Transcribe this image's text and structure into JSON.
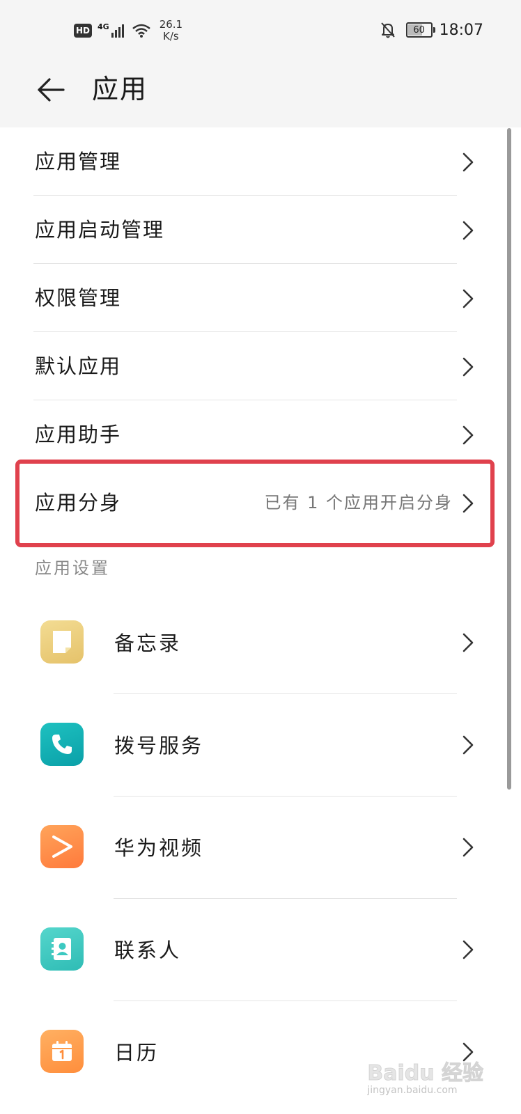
{
  "status_bar": {
    "hd": "HD",
    "network": "4G",
    "speed_value": "26.1",
    "speed_unit": "K/s",
    "battery": "60",
    "time": "18:07",
    "icons": [
      "signal-icon",
      "wifi-icon",
      "notifications-off-icon",
      "battery-icon"
    ]
  },
  "header": {
    "title": "应用",
    "back_icon": "arrow-left-icon"
  },
  "menu": [
    {
      "label": "应用管理"
    },
    {
      "label": "应用启动管理"
    },
    {
      "label": "权限管理"
    },
    {
      "label": "默认应用"
    },
    {
      "label": "应用助手"
    },
    {
      "label": "应用分身",
      "value": "已有 1 个应用开启分身",
      "highlighted": true
    }
  ],
  "app_settings": {
    "header": "应用设置",
    "items": [
      {
        "label": "备忘录",
        "icon": "notepad-icon",
        "color": "#e9cd7c"
      },
      {
        "label": "拨号服务",
        "icon": "phone-icon",
        "color": "#16b3b6"
      },
      {
        "label": "华为视频",
        "icon": "play-icon",
        "color": "#ff8f4a"
      },
      {
        "label": "联系人",
        "icon": "contacts-icon",
        "color": "#3cc9c1"
      },
      {
        "label": "日历",
        "icon": "calendar-icon",
        "color": "#ffa04e"
      }
    ]
  },
  "watermark": {
    "main": "Baidu 经验",
    "sub": "jingyan.baidu.com"
  },
  "colors": {
    "highlight": "#e0414d",
    "background": "#f5f5f5",
    "panel": "#ffffff"
  }
}
